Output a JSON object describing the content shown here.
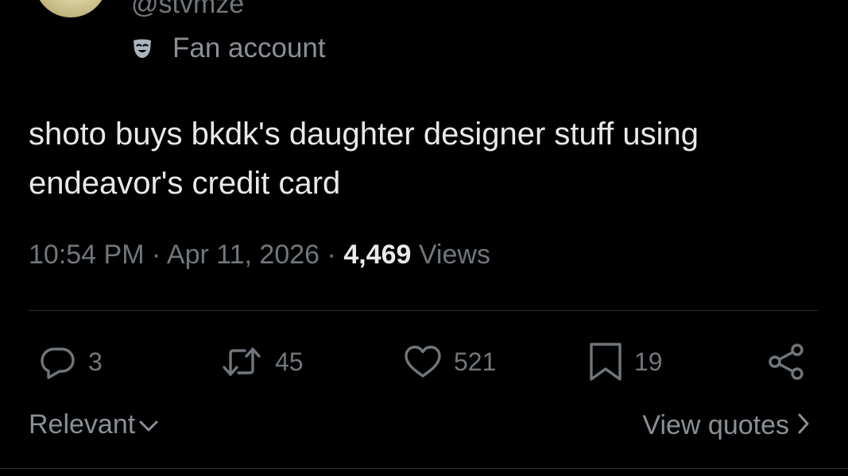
{
  "author": {
    "handle": "@stvmze",
    "label_icon": "theater-mask-icon",
    "label": "Fan account"
  },
  "tweet": {
    "text": "shoto buys bkdk's daughter designer stuff using endeavor's credit card",
    "time": "10:54 PM",
    "separator": "·",
    "date": "Apr 11, 2026",
    "views_count": "4,469",
    "views_label": "Views"
  },
  "actions": {
    "reply": {
      "icon": "reply-icon",
      "count": "3"
    },
    "retweet": {
      "icon": "retweet-icon",
      "count": "45"
    },
    "like": {
      "icon": "heart-icon",
      "count": "521"
    },
    "bookmark": {
      "icon": "bookmark-icon",
      "count": "19"
    },
    "share": {
      "icon": "share-icon"
    }
  },
  "footer": {
    "sort_label": "Relevant",
    "view_quotes_label": "View quotes"
  },
  "colors": {
    "background": "#000000",
    "text_primary": "#e7e9ea",
    "text_secondary": "#71767b",
    "divider": "#2f3336"
  }
}
